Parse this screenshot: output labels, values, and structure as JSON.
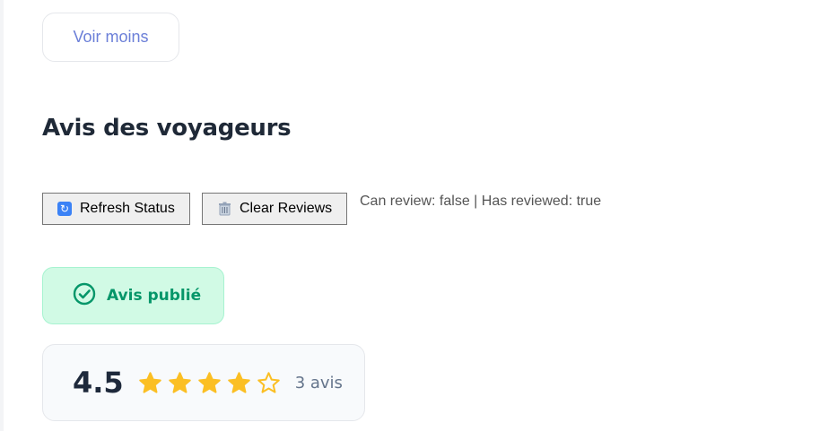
{
  "show_less": {
    "label": "Voir moins"
  },
  "reviews_section": {
    "title": "Avis des voyageurs"
  },
  "debug": {
    "refresh_label": "Refresh Status",
    "clear_label": "Clear Reviews",
    "status_text": "Can review: false | Has reviewed: true"
  },
  "alert": {
    "label": "Avis publié",
    "icon": "check-circle-icon"
  },
  "rating": {
    "value": "4.5",
    "stars": [
      1,
      1,
      1,
      1,
      0
    ],
    "count_label": "3 avis"
  },
  "colors": {
    "accent": "#6b7fd8",
    "success": "#059669",
    "star_filled": "#fbbf24"
  }
}
